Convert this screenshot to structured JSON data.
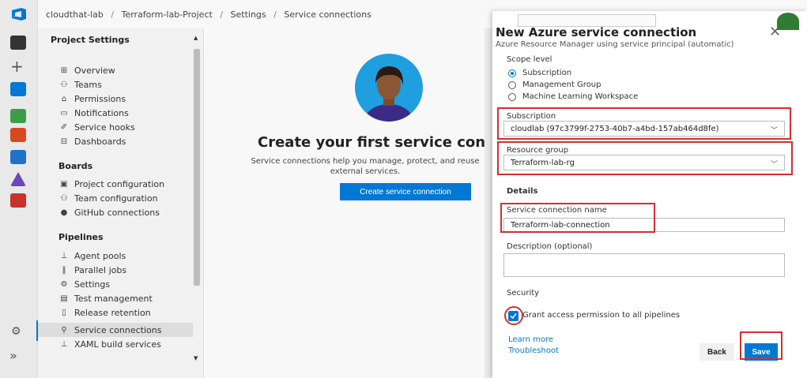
{
  "breadcrumb": [
    "cloudthat-lab",
    "Terraform-lab-Project",
    "Settings",
    "Service connections"
  ],
  "settings": {
    "title": "Project Settings",
    "general_items": [
      {
        "label": "Overview",
        "glyph": "⊞"
      },
      {
        "label": "Teams",
        "glyph": "⚇"
      },
      {
        "label": "Permissions",
        "glyph": "⌂"
      },
      {
        "label": "Notifications",
        "glyph": "▭"
      },
      {
        "label": "Service hooks",
        "glyph": "✐"
      },
      {
        "label": "Dashboards",
        "glyph": "⊟"
      }
    ],
    "boards_title": "Boards",
    "boards_items": [
      {
        "label": "Project configuration",
        "glyph": "▣"
      },
      {
        "label": "Team configuration",
        "glyph": "⚇"
      },
      {
        "label": "GitHub connections",
        "glyph": "●"
      }
    ],
    "pipelines_title": "Pipelines",
    "pipelines_items": [
      {
        "label": "Agent pools",
        "glyph": "⊥"
      },
      {
        "label": "Parallel jobs",
        "glyph": "‖"
      },
      {
        "label": "Settings",
        "glyph": "⚙"
      },
      {
        "label": "Test management",
        "glyph": "▤"
      },
      {
        "label": "Release retention",
        "glyph": "▯"
      },
      {
        "label": "Service connections",
        "glyph": "⚲"
      },
      {
        "label": "XAML build services",
        "glyph": "⊥"
      }
    ]
  },
  "empty_state": {
    "title": "Create your first service con",
    "description": "Service connections help you manage, protect, and reuse external services.",
    "button": "Create service connection"
  },
  "panel": {
    "title": "New Azure service connection",
    "subtitle": "Azure Resource Manager using service principal (automatic)",
    "scope_label": "Scope level",
    "scope_options": [
      "Subscription",
      "Management Group",
      "Machine Learning Workspace"
    ],
    "scope_selected": "Subscription",
    "subscription_label": "Subscription",
    "subscription_value": "cloudlab (97c3799f-2753-40b7-a4bd-157ab464d8fe)",
    "resource_group_label": "Resource group",
    "resource_group_value": "Terraform-lab-rg",
    "details_label": "Details",
    "connection_name_label": "Service connection name",
    "connection_name_value": "Terraform-lab-connection",
    "description_label": "Description (optional)",
    "description_value": "",
    "security_label": "Security",
    "grant_access_label": "Grant access permission to all pipelines",
    "grant_access_checked": true,
    "learn_more": "Learn more",
    "troubleshoot": "Troubleshoot",
    "back_label": "Back",
    "save_label": "Save"
  },
  "colors": {
    "accent": "#0078d4",
    "highlight": "#d32f2f"
  }
}
